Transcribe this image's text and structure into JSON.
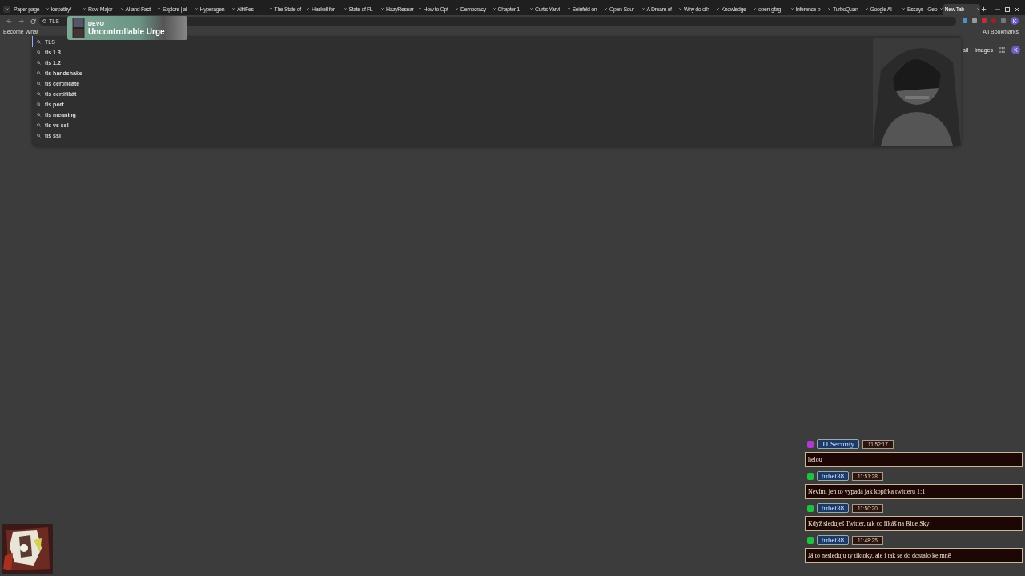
{
  "tabs": [
    {
      "title": "Paper page",
      "selected": false
    },
    {
      "title": "karpathy/",
      "selected": false
    },
    {
      "title": "Row-Major",
      "selected": false
    },
    {
      "title": "AI and Fact",
      "selected": false
    },
    {
      "title": "Explore | al",
      "selected": false
    },
    {
      "title": "Hyperagen",
      "selected": false
    },
    {
      "title": "AltriFes",
      "selected": false
    },
    {
      "title": "The State of",
      "selected": false
    },
    {
      "title": "Haskell for",
      "selected": false
    },
    {
      "title": "State of FL",
      "selected": false
    },
    {
      "title": "HazyResear",
      "selected": false
    },
    {
      "title": "How to Opt",
      "selected": false
    },
    {
      "title": "Democracy",
      "selected": false
    },
    {
      "title": "Chapter 1",
      "selected": false
    },
    {
      "title": "Curtis Yarvi",
      "selected": false
    },
    {
      "title": "Seinfeld on",
      "selected": false
    },
    {
      "title": "Open-Sour",
      "selected": false
    },
    {
      "title": "A Dream of",
      "selected": false
    },
    {
      "title": "Why do oth",
      "selected": false
    },
    {
      "title": "Knowledge",
      "selected": false
    },
    {
      "title": "open-gfag",
      "selected": false
    },
    {
      "title": "Inference b",
      "selected": false
    },
    {
      "title": "TurboQuan",
      "selected": false
    },
    {
      "title": "Google AI",
      "selected": false
    },
    {
      "title": "Essays - Geo",
      "selected": false
    },
    {
      "title": "New Tab",
      "selected": true
    }
  ],
  "toolbar": {
    "address": "TLS",
    "profile": "K"
  },
  "bookmarks": {
    "items": [
      "Become What"
    ],
    "all": "All Bookmarks"
  },
  "omnibox": {
    "query": "TLS",
    "suggestions": [
      "tls 1.3",
      "tls 1.2",
      "tls handshake",
      "tls certificate",
      "tls certifikát",
      "tls port",
      "tls meaning",
      "tls vs ssl",
      "tls ssl"
    ]
  },
  "google": {
    "links": [
      "ail",
      "Images"
    ],
    "avatar": "K"
  },
  "now_playing": {
    "artist": "DEVO",
    "title": "Uncontrollable Urge"
  },
  "chat": [
    {
      "user": "TLSecurity",
      "time": "11:52:17",
      "color": "#b03ad0",
      "text": "helou"
    },
    {
      "user": "tribet38",
      "time": "11:51:28",
      "color": "#22c040",
      "text": "Nevím, jen to vypadá jak kopírka twitteru 1:1"
    },
    {
      "user": "tribet38",
      "time": "11:50:20",
      "color": "#22c040",
      "text": "Když sleduješ Twitter, tak co říkáš na Blue Sky"
    },
    {
      "user": "tribet38",
      "time": "11:48:25",
      "color": "#22c040",
      "text": "Já to nesleduju ty tiktoky, ale i tak se do dostalo ke mně"
    }
  ]
}
